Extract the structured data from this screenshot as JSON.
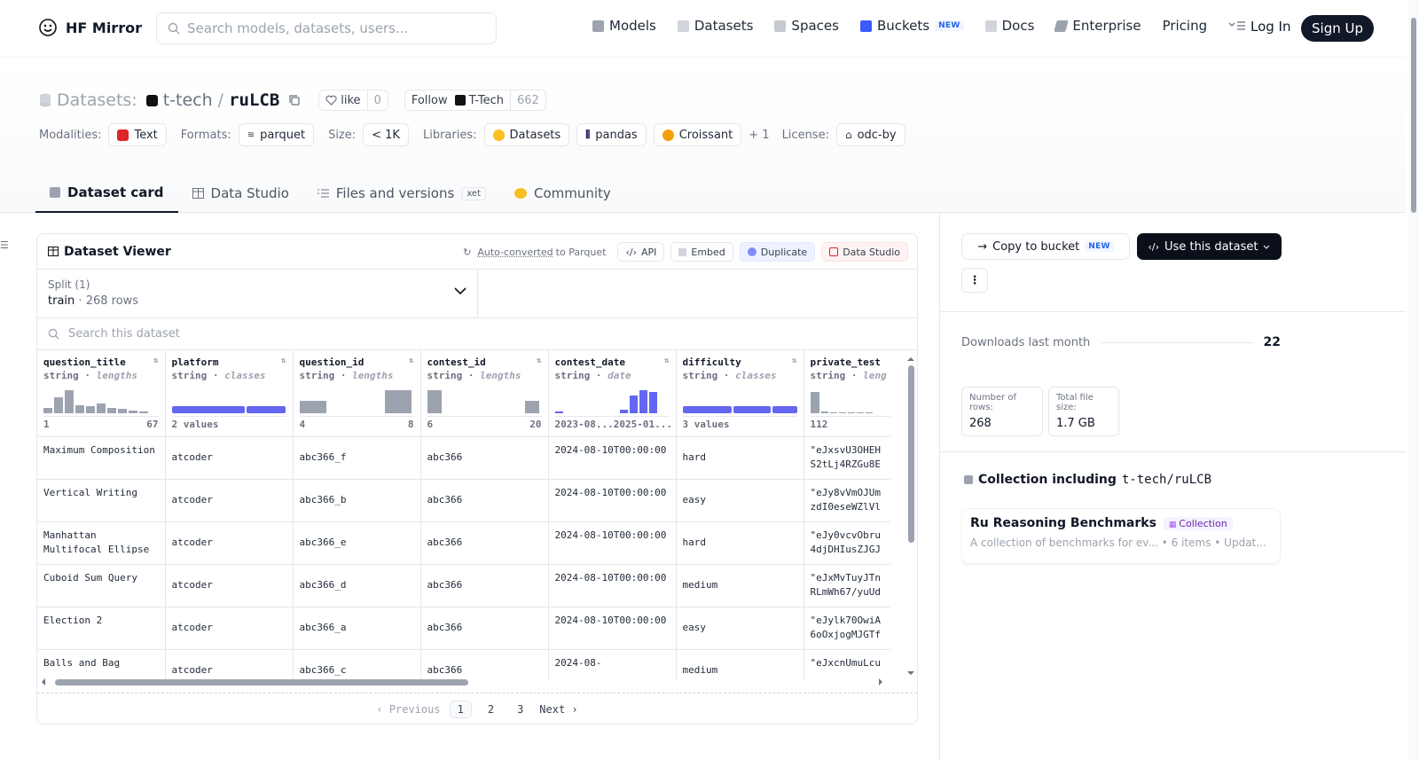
{
  "nav": {
    "brand": "HF Mirror",
    "search_placeholder": "Search models, datasets, users...",
    "links": {
      "models": "Models",
      "datasets": "Datasets",
      "spaces": "Spaces",
      "buckets": "Buckets",
      "buckets_badge": "NEW",
      "docs": "Docs",
      "enterprise": "Enterprise",
      "pricing": "Pricing"
    },
    "login": "Log In",
    "signup": "Sign Up"
  },
  "header": {
    "prefix": "Datasets:",
    "org": "t-tech",
    "slash": "/",
    "name": "ruLCB",
    "like_label": "like",
    "like_count": "0",
    "follow_label": "Follow",
    "follow_org": "T-Tech",
    "follow_count": "662",
    "meta": {
      "modalities_label": "Modalities:",
      "modalities_value": "Text",
      "formats_label": "Formats:",
      "formats_value": "parquet",
      "size_label": "Size:",
      "size_value": "< 1K",
      "libraries_label": "Libraries:",
      "libraries": [
        "Datasets",
        "pandas",
        "Croissant"
      ],
      "libraries_more": "+ 1",
      "license_label": "License:",
      "license_value": "odc-by"
    },
    "tabs": {
      "card": "Dataset card",
      "studio": "Data Studio",
      "files": "Files and versions",
      "files_badge": "xet",
      "community": "Community"
    }
  },
  "viewer": {
    "title": "Dataset Viewer",
    "auto_link": "Auto-converted",
    "auto_rest": "to Parquet",
    "api": "API",
    "embed": "Embed",
    "duplicate": "Duplicate",
    "data_studio": "Data Studio",
    "split_label": "Split (1)",
    "split_name": "train",
    "split_dot": "·",
    "split_rows": "268 rows",
    "search_placeholder": "Search this dataset",
    "columns": [
      {
        "name": "question_title",
        "type": "string",
        "kind": "lengths",
        "min": "1",
        "max": "67"
      },
      {
        "name": "platform",
        "type": "string",
        "kind": "classes",
        "min": "2 values",
        "max": ""
      },
      {
        "name": "question_id",
        "type": "string",
        "kind": "lengths",
        "min": "4",
        "max": "8"
      },
      {
        "name": "contest_id",
        "type": "string",
        "kind": "lengths",
        "min": "6",
        "max": "20"
      },
      {
        "name": "contest_date",
        "type": "string",
        "kind": "date",
        "min": "2023-08...",
        "max": "2025-01..."
      },
      {
        "name": "difficulty",
        "type": "string",
        "kind": "classes",
        "min": "3 values",
        "max": ""
      },
      {
        "name": "private_test",
        "type": "string",
        "kind": "leng",
        "min": "112",
        "max": ""
      }
    ],
    "rows": [
      {
        "c0": "Maximum Composition",
        "c1": "atcoder",
        "c2": "abc366_f",
        "c3": "abc366",
        "c4": "2024-08-10T00:00:00",
        "c5": "hard",
        "c6": "\"eJxsvU3OHEH S2tLj4RZGu8E"
      },
      {
        "c0": "Vertical Writing",
        "c1": "atcoder",
        "c2": "abc366_b",
        "c3": "abc366",
        "c4": "2024-08-10T00:00:00",
        "c5": "easy",
        "c6": "\"eJy8vVmOJUm zdI0eseWZlVl"
      },
      {
        "c0": "Manhattan Multifocal Ellipse",
        "c1": "atcoder",
        "c2": "abc366_e",
        "c3": "abc366",
        "c4": "2024-08-10T00:00:00",
        "c5": "hard",
        "c6": "\"eJy0vcvObru 4djDHIusZJGJ"
      },
      {
        "c0": "Cuboid Sum Query",
        "c1": "atcoder",
        "c2": "abc366_d",
        "c3": "abc366",
        "c4": "2024-08-10T00:00:00",
        "c5": "medium",
        "c6": "\"eJxMvTuyJTn RLmWh67/yuUd"
      },
      {
        "c0": "Election 2",
        "c1": "atcoder",
        "c2": "abc366_a",
        "c3": "abc366",
        "c4": "2024-08-10T00:00:00",
        "c5": "easy",
        "c6": "\"eJylk70OwiA 6oOxjogMJGTf"
      },
      {
        "c0": "Balls and Bag",
        "c1": "atcoder",
        "c2": "abc366_c",
        "c3": "abc366",
        "c4": "2024-08-",
        "c5": "medium",
        "c6": "\"eJxcnUmuLcu"
      }
    ],
    "pager": {
      "prev": "Previous",
      "p1": "1",
      "p2": "2",
      "p3": "3",
      "next": "Next"
    }
  },
  "sidebar": {
    "copy_bucket": "Copy to bucket",
    "copy_badge": "NEW",
    "use_dataset": "Use this dataset",
    "more": "⋮",
    "downloads_label": "Downloads last month",
    "downloads_value": "22",
    "rows_label": "Number of rows:",
    "rows_value": "268",
    "size_label": "Total file size:",
    "size_value": "1.7 GB",
    "collection_heading": "Collection including",
    "collection_repo": "t-tech/ruLCB",
    "collection_title": "Ru Reasoning Benchmarks",
    "collection_tag": "Collection",
    "collection_desc": "A collection of benchmarks for ev...",
    "collection_items": "• 6 items",
    "collection_updated": "• Updat..."
  },
  "colors": {
    "accent": "#6366f1",
    "dark": "#0b0f19",
    "muted": "#6b7280"
  }
}
